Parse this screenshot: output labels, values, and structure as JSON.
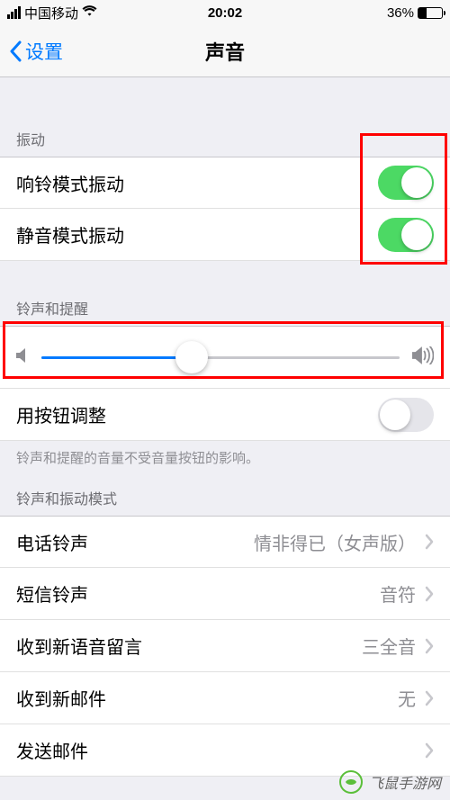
{
  "status_bar": {
    "carrier": "中国移动",
    "time": "20:02",
    "battery_pct": "36%"
  },
  "nav": {
    "back_label": "设置",
    "title": "声音"
  },
  "sections": {
    "vibration_header": "振动",
    "ringer_alerts_header": "铃声和提醒",
    "patterns_header": "铃声和振动模式"
  },
  "rows": {
    "vibrate_on_ring": "响铃模式振动",
    "vibrate_on_silent": "静音模式振动",
    "change_with_buttons": "用按钮调整",
    "ringtone": {
      "label": "电话铃声",
      "value": "情非得已（女声版）"
    },
    "text_tone": {
      "label": "短信铃声",
      "value": "音符"
    },
    "new_voicemail": {
      "label": "收到新语音留言",
      "value": "三全音"
    },
    "new_mail": {
      "label": "收到新邮件",
      "value": "无"
    },
    "sent_mail": {
      "label": "发送邮件",
      "value": ""
    }
  },
  "toggles": {
    "vibrate_on_ring": true,
    "vibrate_on_silent": true,
    "change_with_buttons": false
  },
  "slider": {
    "value_pct": 42
  },
  "footer_note": "铃声和提醒的音量不受音量按钮的影响。",
  "watermark": {
    "text": "飞鼠手游网",
    "url": "www.fsxtgsy.com"
  },
  "colors": {
    "accent": "#007aff",
    "switch_on": "#4cd964",
    "highlight": "#ff0000"
  }
}
